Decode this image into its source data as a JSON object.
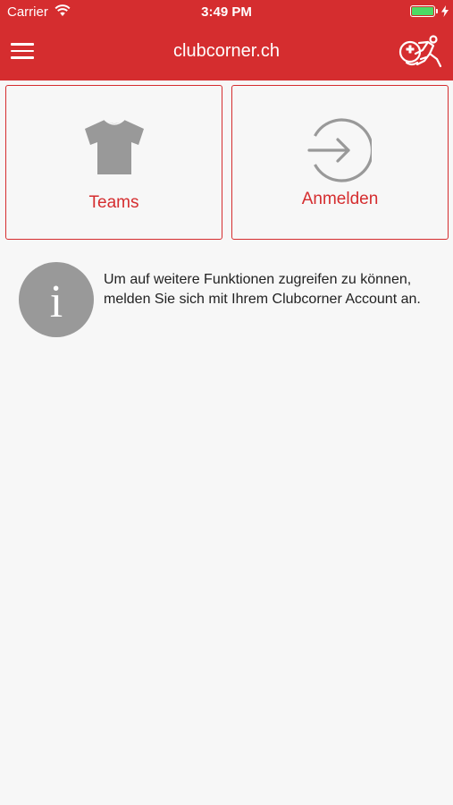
{
  "status_bar": {
    "carrier": "Carrier",
    "time": "3:49 PM"
  },
  "navbar": {
    "title": "clubcorner.ch",
    "menu_icon": "hamburger-menu-icon",
    "logo_icon": "swiss-football-logo"
  },
  "tiles": [
    {
      "label": "Teams",
      "icon": "shirt-icon"
    },
    {
      "label": "Anmelden",
      "icon": "login-arrow-icon"
    }
  ],
  "info": {
    "icon": "info-icon",
    "text": "Um auf weitere Funktionen zugreifen zu können, melden Sie sich mit Ihrem Clubcorner Account an."
  },
  "colors": {
    "brand_red": "#d52d2f",
    "icon_gray": "#999999",
    "background": "#f7f7f7"
  }
}
